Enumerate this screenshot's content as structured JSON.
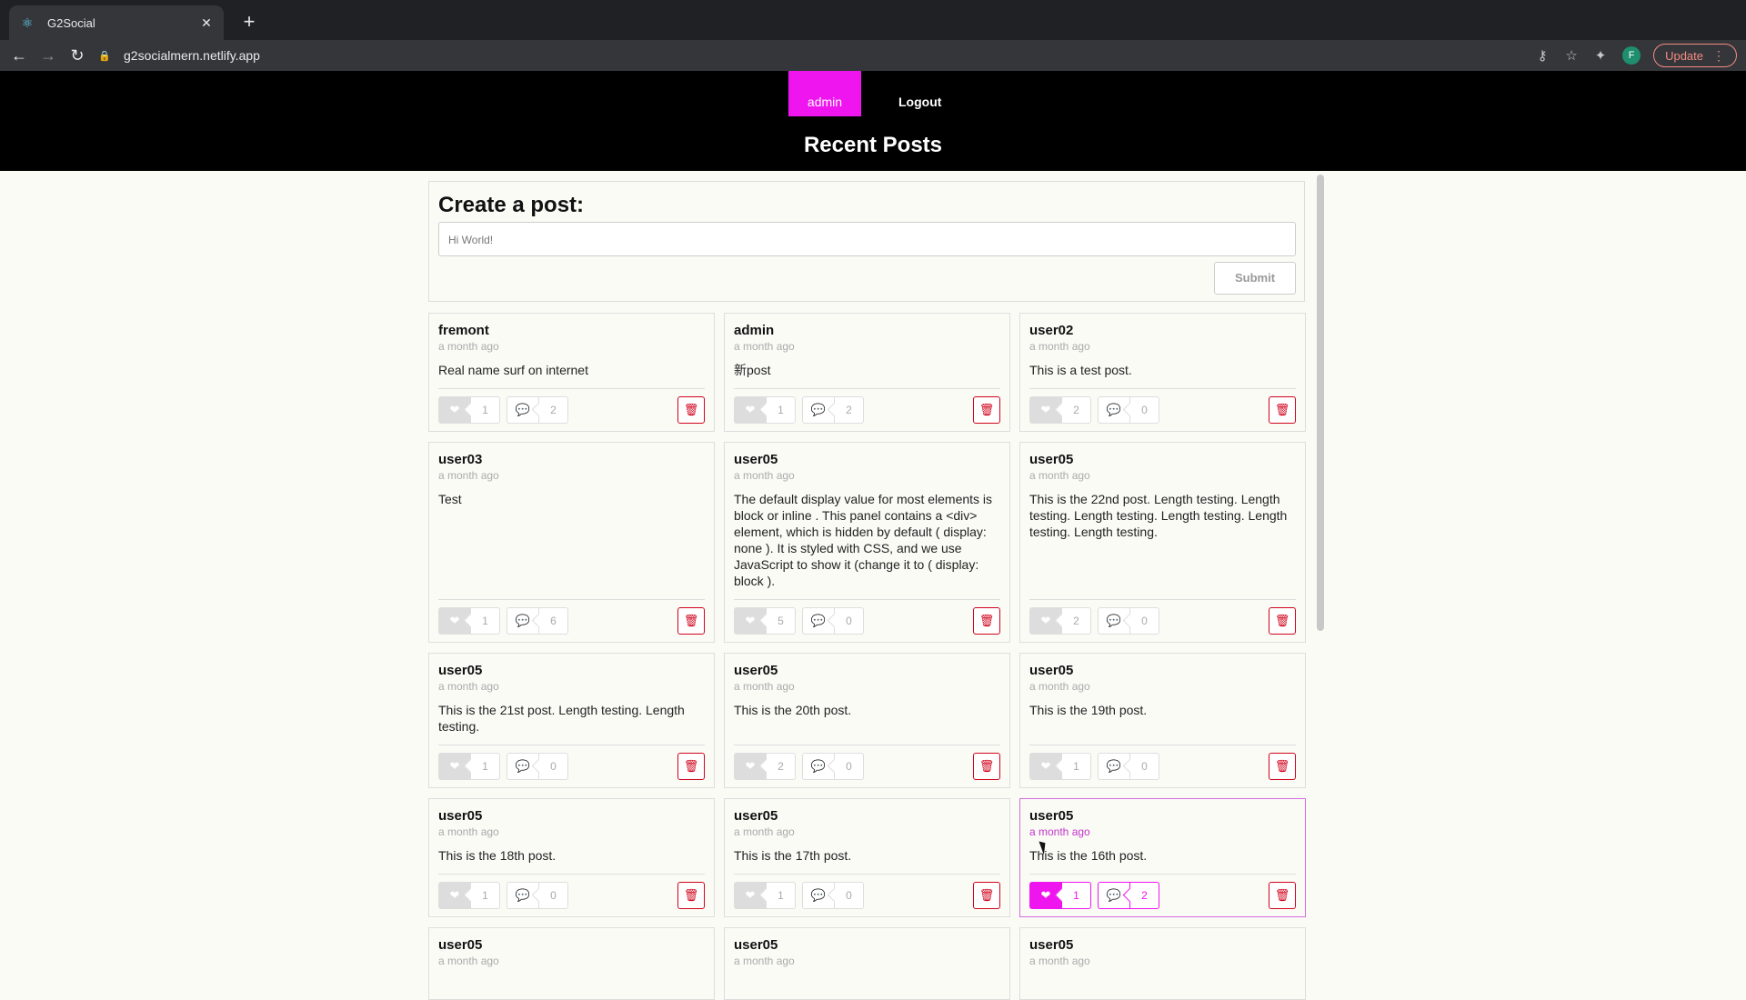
{
  "browser": {
    "tab_title": "G2Social",
    "tab_favicon": "react-icon",
    "url": "g2socialmern.netlify.app",
    "profile_initial": "F",
    "update_label": "Update"
  },
  "header": {
    "nav_admin": "admin",
    "nav_logout": "Logout",
    "title": "Recent Posts",
    "accent_color": "#ef15ef"
  },
  "create_post": {
    "heading": "Create a post:",
    "input_placeholder": "Hi World!",
    "submit_label": "Submit"
  },
  "posts": [
    {
      "user": "fremont",
      "time": "a month ago",
      "content": "Real name surf on internet",
      "likes": "1",
      "comments": "2"
    },
    {
      "user": "admin",
      "time": "a month ago",
      "content": "新post",
      "likes": "1",
      "comments": "2"
    },
    {
      "user": "user02",
      "time": "a month ago",
      "content": "This is a test post.",
      "likes": "2",
      "comments": "0"
    },
    {
      "user": "user03",
      "time": "a month ago",
      "content": "Test",
      "likes": "1",
      "comments": "6"
    },
    {
      "user": "user05",
      "time": "a month ago",
      "content": "The default display value for most elements is block or inline . This panel contains a <div> element, which is hidden by default ( display: none ). It is styled with CSS, and we use JavaScript to show it (change it to ( display: block ).",
      "likes": "5",
      "comments": "0"
    },
    {
      "user": "user05",
      "time": "a month ago",
      "content": "This is the 22nd post. Length testing. Length testing. Length testing. Length testing. Length testing. Length testing.",
      "likes": "2",
      "comments": "0"
    },
    {
      "user": "user05",
      "time": "a month ago",
      "content": "This is the 21st post. Length testing. Length testing.",
      "likes": "1",
      "comments": "0"
    },
    {
      "user": "user05",
      "time": "a month ago",
      "content": "This is the 20th post.",
      "likes": "2",
      "comments": "0"
    },
    {
      "user": "user05",
      "time": "a month ago",
      "content": "This is the 19th post.",
      "likes": "1",
      "comments": "0"
    },
    {
      "user": "user05",
      "time": "a month ago",
      "content": "This is the 18th post.",
      "likes": "1",
      "comments": "0"
    },
    {
      "user": "user05",
      "time": "a month ago",
      "content": "This is the 17th post.",
      "likes": "1",
      "comments": "0"
    },
    {
      "user": "user05",
      "time": "a month ago",
      "content": "This is the 16th post.",
      "likes": "1",
      "comments": "2"
    },
    {
      "user": "user05",
      "time": "a month ago"
    },
    {
      "user": "user05",
      "time": "a month ago"
    },
    {
      "user": "user05",
      "time": "a month ago"
    }
  ],
  "icons": {
    "like": "heart-icon",
    "comment": "comment-icon",
    "delete": "trash-icon"
  }
}
